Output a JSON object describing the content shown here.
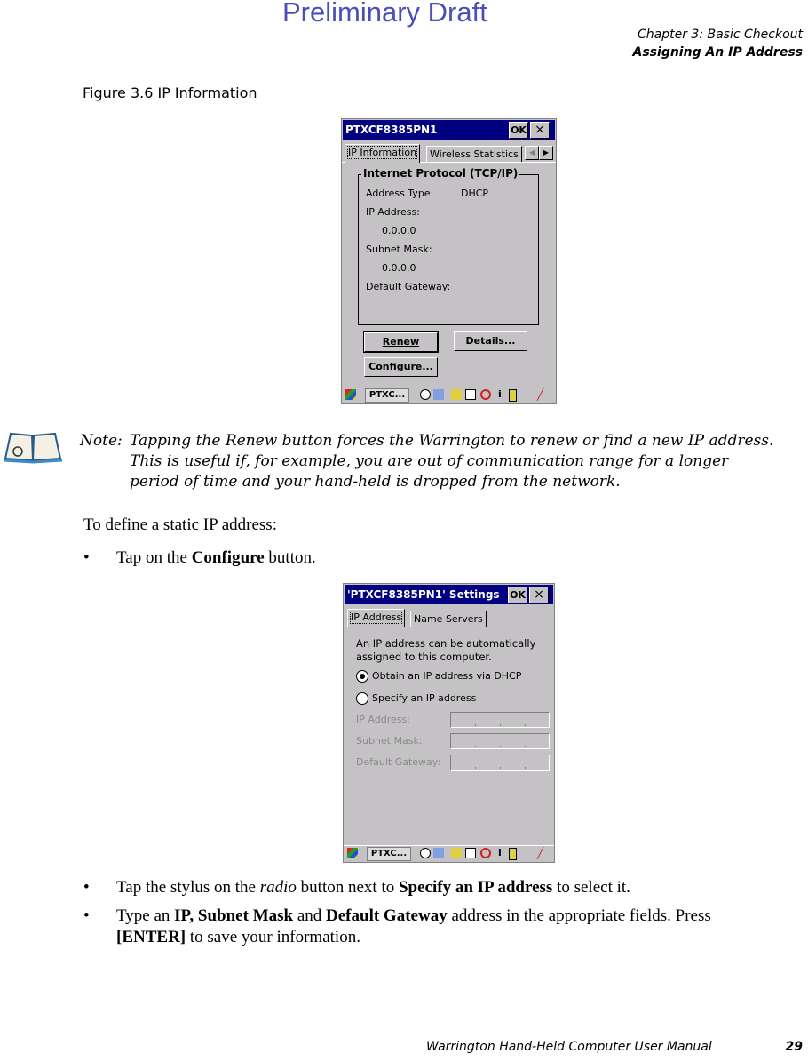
{
  "header": {
    "watermark": "Preliminary Draft",
    "chapter": "Chapter 3:  Basic Checkout",
    "section": "Assigning An IP Address"
  },
  "figure": {
    "caption": "Figure 3.6  IP Information",
    "window": {
      "title": "PTXCF8385PN1",
      "ok_label": "OK",
      "close_label": "×",
      "tabs": [
        "IP Information",
        "Wireless Statistics"
      ],
      "group_label": "Internet Protocol (TCP/IP)",
      "address_type_label": "Address Type:",
      "address_type_value": "DHCP",
      "ip_label": "IP Address:",
      "ip_value": "0.0.0.0",
      "subnet_label": "Subnet Mask:",
      "subnet_value": "0.0.0.0",
      "gateway_label": "Default Gateway:",
      "gateway_value": "",
      "renew_label": "Renew",
      "details_label": "Details...",
      "configure_label": "Configure..."
    }
  },
  "taskbar": {
    "task_label": "PTXC...",
    "icons": [
      "start-flag-icon",
      "network-globe-icon",
      "network-adapter-icon",
      "lock-icon",
      "connection-icon",
      "no-signal-icon",
      "info-icon",
      "battery-icon",
      "pen-icon"
    ]
  },
  "note": {
    "label": "Note:",
    "line1": "Tapping the Renew button forces the Warrington to renew or find a new IP address.",
    "line2": "This is useful if, for example, you are out of communication range for a longer",
    "line3": "period of time and your hand-held is dropped from the network."
  },
  "instructions": {
    "intro": "To define a static IP address:",
    "bullet1": {
      "pre": "Tap on the ",
      "bold": "Configure",
      "post": " button."
    },
    "bullet2": {
      "pre": "Tap the stylus on the ",
      "italic": "radio",
      "mid": " button next to ",
      "bold": "Specify an IP address",
      "post": " to select it."
    },
    "bullet3": {
      "pre": "Type an ",
      "bold1": "IP, Subnet Mask",
      "mid": " and ",
      "bold2": "Default Gateway",
      "post": " address in the appropriate fields. Press",
      "bold3": "[ENTER]",
      "post2": " to save your information."
    }
  },
  "settings_window": {
    "title": "'PTXCF8385PN1' Settings",
    "ok_label": "OK",
    "close_label": "×",
    "tabs": [
      "IP Address",
      "Name Servers"
    ],
    "desc_line1": "An IP address can be automatically",
    "desc_line2": "assigned to this computer.",
    "radio_dhcp": "Obtain an IP address via DHCP",
    "radio_dhcp_selected": true,
    "radio_specify": "Specify an IP address",
    "ip_label": "IP Address:",
    "subnet_label": "Subnet Mask:",
    "gateway_label": "Default Gateway:"
  },
  "footer": {
    "manual": "Warrington Hand-Held Computer User Manual",
    "page": "29"
  }
}
